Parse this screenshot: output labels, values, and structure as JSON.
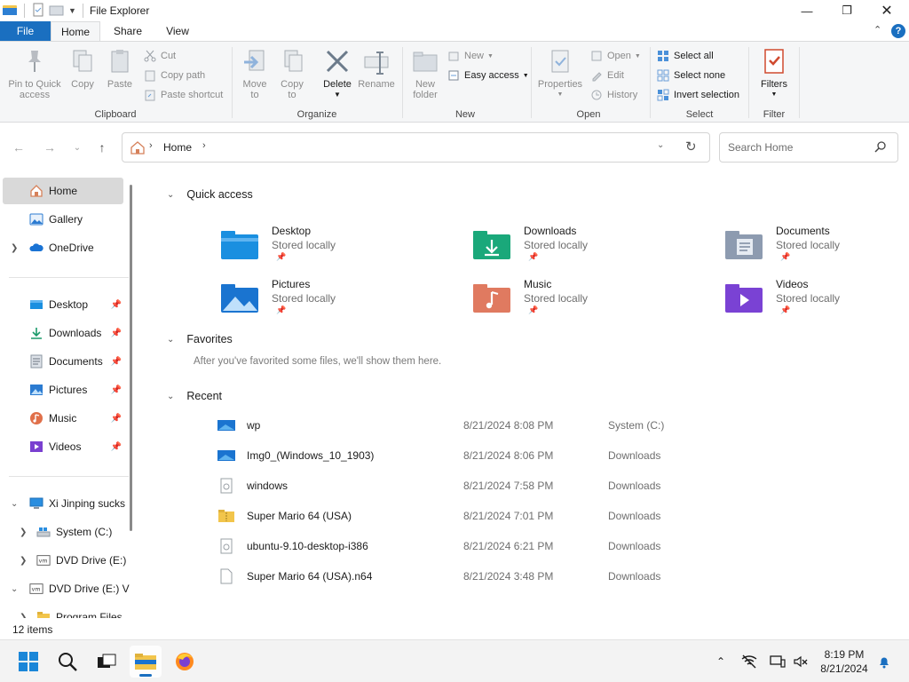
{
  "window": {
    "title": "File Explorer"
  },
  "ribbon_tabs": {
    "file": "File",
    "home": "Home",
    "share": "Share",
    "view": "View"
  },
  "ribbon": {
    "clipboard": {
      "pin": "Pin to Quick access",
      "copy": "Copy",
      "paste": "Paste",
      "cut": "Cut",
      "copy_path": "Copy path",
      "paste_shortcut": "Paste shortcut",
      "label": "Clipboard"
    },
    "organize": {
      "move_to": "Move to",
      "copy_to": "Copy to",
      "delete": "Delete",
      "rename": "Rename",
      "label": "Organize"
    },
    "new": {
      "new_folder": "New folder",
      "new_item": "New",
      "easy_access": "Easy access",
      "label": "New"
    },
    "open": {
      "properties": "Properties",
      "open": "Open",
      "edit": "Edit",
      "history": "History",
      "label": "Open"
    },
    "select": {
      "select_all": "Select all",
      "select_none": "Select none",
      "invert": "Invert selection",
      "label": "Select"
    },
    "filter": {
      "filters": "Filters",
      "label": "Filter"
    }
  },
  "address": {
    "crumb": "Home",
    "search_placeholder": "Search Home"
  },
  "sidebar": {
    "items": [
      {
        "label": "Home",
        "icon": "home-icon",
        "selected": true
      },
      {
        "label": "Gallery",
        "icon": "gallery-icon"
      },
      {
        "label": "OneDrive",
        "icon": "onedrive-icon",
        "expandable": true
      },
      {
        "label": "Desktop",
        "icon": "desktop-icon",
        "pinned": true
      },
      {
        "label": "Downloads",
        "icon": "downloads-icon",
        "pinned": true
      },
      {
        "label": "Documents",
        "icon": "documents-icon",
        "pinned": true
      },
      {
        "label": "Pictures",
        "icon": "pictures-icon",
        "pinned": true
      },
      {
        "label": "Music",
        "icon": "music-icon",
        "pinned": true
      },
      {
        "label": "Videos",
        "icon": "videos-icon",
        "pinned": true
      },
      {
        "label": "Xi Jinping sucks",
        "icon": "computer-icon",
        "expanded": true
      },
      {
        "label": "System (C:)",
        "icon": "drive-icon"
      },
      {
        "label": "DVD Drive (E:)",
        "icon": "dvd-icon"
      },
      {
        "label": "DVD Drive (E:) V",
        "icon": "dvd-icon",
        "expanded": true
      },
      {
        "label": "Program Files",
        "icon": "folder-icon"
      }
    ]
  },
  "main": {
    "quick_access": {
      "title": "Quick access",
      "tiles": [
        {
          "name": "Desktop",
          "sub": "Stored locally"
        },
        {
          "name": "Downloads",
          "sub": "Stored locally"
        },
        {
          "name": "Documents",
          "sub": "Stored locally"
        },
        {
          "name": "Pictures",
          "sub": "Stored locally"
        },
        {
          "name": "Music",
          "sub": "Stored locally"
        },
        {
          "name": "Videos",
          "sub": "Stored locally"
        }
      ]
    },
    "favorites": {
      "title": "Favorites",
      "empty_text": "After you've favorited some files, we'll show them here."
    },
    "recent": {
      "title": "Recent",
      "rows": [
        {
          "name": "wp",
          "date": "8/21/2024 8:08 PM",
          "location": "System (C:)"
        },
        {
          "name": "Img0_(Windows_10_1903)",
          "date": "8/21/2024 8:06 PM",
          "location": "Downloads"
        },
        {
          "name": "windows",
          "date": "8/21/2024 7:58 PM",
          "location": "Downloads"
        },
        {
          "name": "Super Mario 64 (USA)",
          "date": "8/21/2024 7:01 PM",
          "location": "Downloads"
        },
        {
          "name": "ubuntu-9.10-desktop-i386",
          "date": "8/21/2024 6:21 PM",
          "location": "Downloads"
        },
        {
          "name": "Super Mario 64 (USA).n64",
          "date": "8/21/2024 3:48 PM",
          "location": "Downloads"
        }
      ]
    }
  },
  "status": {
    "item_count": "12 items"
  },
  "taskbar": {
    "time": "8:19 PM",
    "date": "8/21/2024"
  },
  "colors": {
    "accent": "#1a6fc0",
    "folder_yellow": "#f2c54b"
  }
}
